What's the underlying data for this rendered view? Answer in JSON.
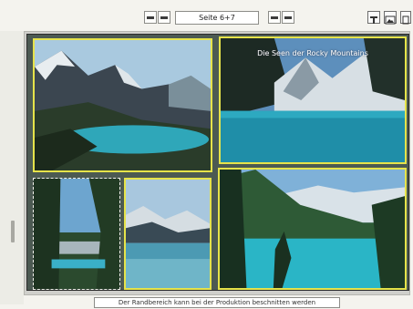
{
  "toolbar": {
    "page_label": "Seite 6+7"
  },
  "spread": {
    "caption": "Die Seen der Rocky Mountains"
  },
  "footer": {
    "notice": "Der Randbereich kann bei der Produktion beschnitten werden"
  },
  "icons": [
    "prev-spread-icon",
    "prev-page-icon",
    "next-page-icon",
    "next-spread-icon",
    "text-frame-icon",
    "image-frame-icon",
    "info-icon"
  ]
}
